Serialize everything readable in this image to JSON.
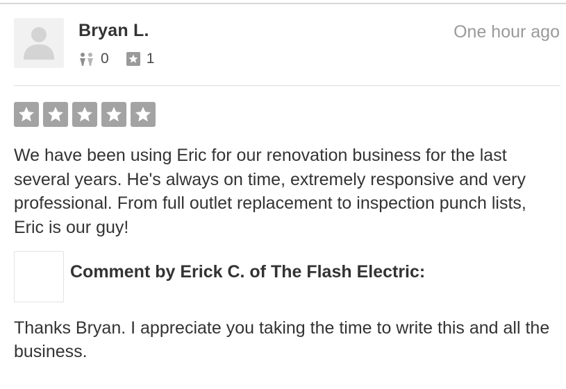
{
  "review": {
    "user_name": "Bryan L.",
    "timestamp": "One hour ago",
    "friends_count": "0",
    "reviews_count": "1",
    "rating": 5,
    "rating_max": 5,
    "text": "We have been using Eric for our renovation business for the last several years. He's always on time, extremely responsive and very professional. From full outlet replacement to inspection punch lists, Eric is our guy!"
  },
  "comment": {
    "header": "Comment by Erick C. of The Flash Electric:",
    "text": "Thanks Bryan. I appreciate you taking the time to write this and all the business."
  },
  "icons": {
    "avatar": "user-silhouette-icon",
    "friends": "friends-icon",
    "reviews": "star-badge-icon",
    "rating_star": "star-icon"
  },
  "colors": {
    "star_box": "#a3a3a3",
    "timestamp": "#9a9a9a",
    "text": "#333333"
  }
}
